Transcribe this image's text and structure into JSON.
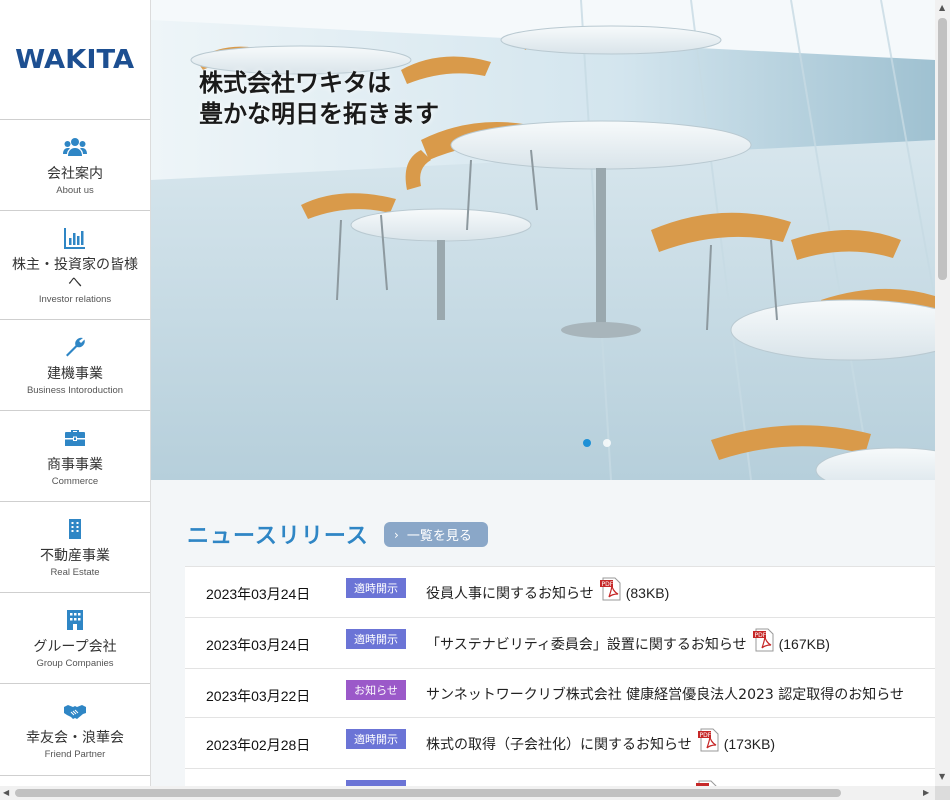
{
  "logo": {
    "text": "WAKITA"
  },
  "nav": [
    {
      "jp": "会社案内",
      "en": "About us",
      "icon": "users-icon"
    },
    {
      "jp": "株主・投資家の皆様へ",
      "en": "Investor relations",
      "icon": "bar-chart-icon"
    },
    {
      "jp": "建機事業",
      "en": "Business Intoroduction",
      "icon": "wrench-icon"
    },
    {
      "jp": "商事事業",
      "en": "Commerce",
      "icon": "briefcase-icon"
    },
    {
      "jp": "不動産事業",
      "en": "Real Estate",
      "icon": "building-icon"
    },
    {
      "jp": "グループ会社",
      "en": "Group Companies",
      "icon": "office-building-icon"
    },
    {
      "jp": "幸友会・浪華会",
      "en": "Friend Partner",
      "icon": "handshake-icon"
    }
  ],
  "hero": {
    "line1": "株式会社ワキタは",
    "line2": "豊かな明日を拓きます",
    "active_slide": 1,
    "slide_count": 2
  },
  "news": {
    "heading": "ニュースリリース",
    "view_all": "一覧を見る",
    "items": [
      {
        "date": "2023年03月24日",
        "tag": "適時開示",
        "tag_color": "#6b74d6",
        "text": "役員人事に関するお知らせ",
        "pdf": true,
        "size": "(83KB)"
      },
      {
        "date": "2023年03月24日",
        "tag": "適時開示",
        "tag_color": "#6b74d6",
        "text": "「サステナビリティ委員会」設置に関するお知らせ",
        "pdf": true,
        "size": "(167KB)"
      },
      {
        "date": "2023年03月22日",
        "tag": "お知らせ",
        "tag_color": "#9b59c9",
        "text": "サンネットワークリブ株式会社 健康経営優良法人2023 認定取得のお知らせ",
        "pdf": false,
        "size": ""
      },
      {
        "date": "2023年02月28日",
        "tag": "適時開示",
        "tag_color": "#6b74d6",
        "text": "株式の取得（子会社化）に関するお知らせ",
        "pdf": true,
        "size": "(173KB)"
      }
    ]
  },
  "colors": {
    "brand_blue": "#1d4f91",
    "accent_blue": "#2f86c5",
    "icon_blue": "#2f86c5"
  }
}
